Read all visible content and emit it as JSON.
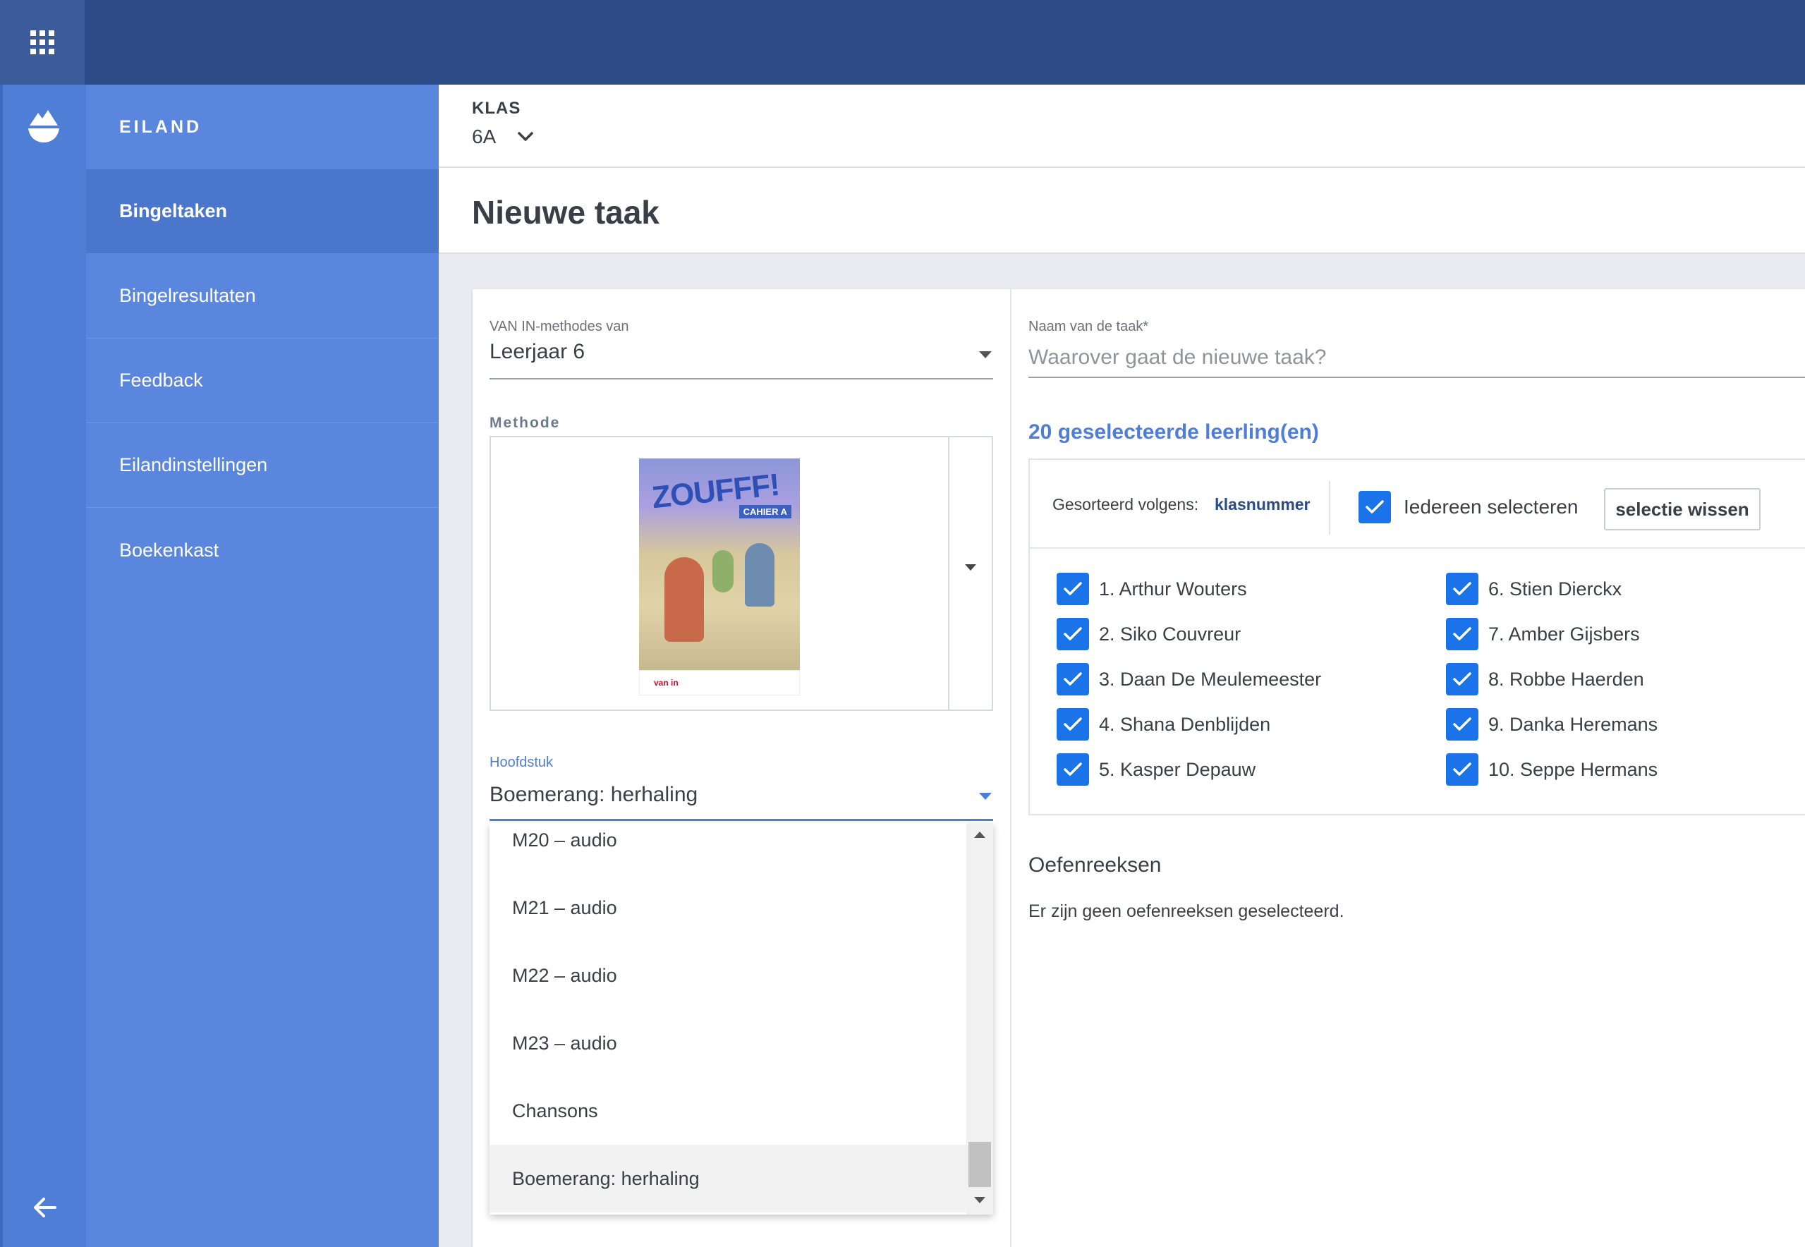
{
  "sidebar": {
    "title": "EILAND",
    "items": [
      {
        "label": "Bingeltaken",
        "active": true
      },
      {
        "label": "Bingelresultaten"
      },
      {
        "label": "Feedback"
      },
      {
        "label": "Eilandinstellingen"
      },
      {
        "label": "Boekenkast"
      }
    ]
  },
  "klas": {
    "label": "KLAS",
    "value": "6A"
  },
  "page": {
    "title": "Nieuwe taak"
  },
  "form": {
    "methodes_label": "VAN IN-methodes van",
    "methodes_value": "Leerjaar 6",
    "methode_label": "Methode",
    "cover": {
      "brand": "ZOUFFF!",
      "badge": "CAHIER A",
      "publisher": "van in"
    },
    "hoofdstuk_label": "Hoofdstuk",
    "hoofdstuk_value": "Boemerang: herhaling",
    "hoofdstuk_options": [
      "M20 – audio",
      "M21 – audio",
      "M22 – audio",
      "M23 – audio",
      "Chansons",
      "Boemerang: herhaling"
    ]
  },
  "task": {
    "naam_label": "Naam van de taak*",
    "naam_placeholder": "Waarover gaat de nieuwe taak?",
    "selected_count": "20 geselecteerde leerling(en)",
    "sort_label": "Gesorteerd volgens:",
    "sort_value": "klasnummer",
    "select_all_label": "Iedereen selecteren",
    "clear_label": "selectie wissen",
    "students": [
      "1. Arthur Wouters",
      "2. Siko Couvreur",
      "3. Daan De Meulemeester",
      "4. Shana Denblijden",
      "5. Kasper Depauw",
      "6. Stien Dierckx",
      "7. Amber Gijsbers",
      "8. Robbe Haerden",
      "9. Danka Heremans",
      "10. Seppe Hermans"
    ],
    "oefenreeksen_title": "Oefenreeksen",
    "oefenreeksen_empty": "Er zijn geen oefenreeksen geselecteerd."
  },
  "colors": {
    "topbar": "#2c4a85",
    "sidebar": "#5a86de",
    "accent": "#4f7ed6",
    "checkbox": "#1a73e8"
  },
  "icons": {
    "apps": "grid-icon",
    "logo": "island-icon",
    "back": "arrow-left-icon",
    "klas_toggle": "chevron-down-icon"
  }
}
